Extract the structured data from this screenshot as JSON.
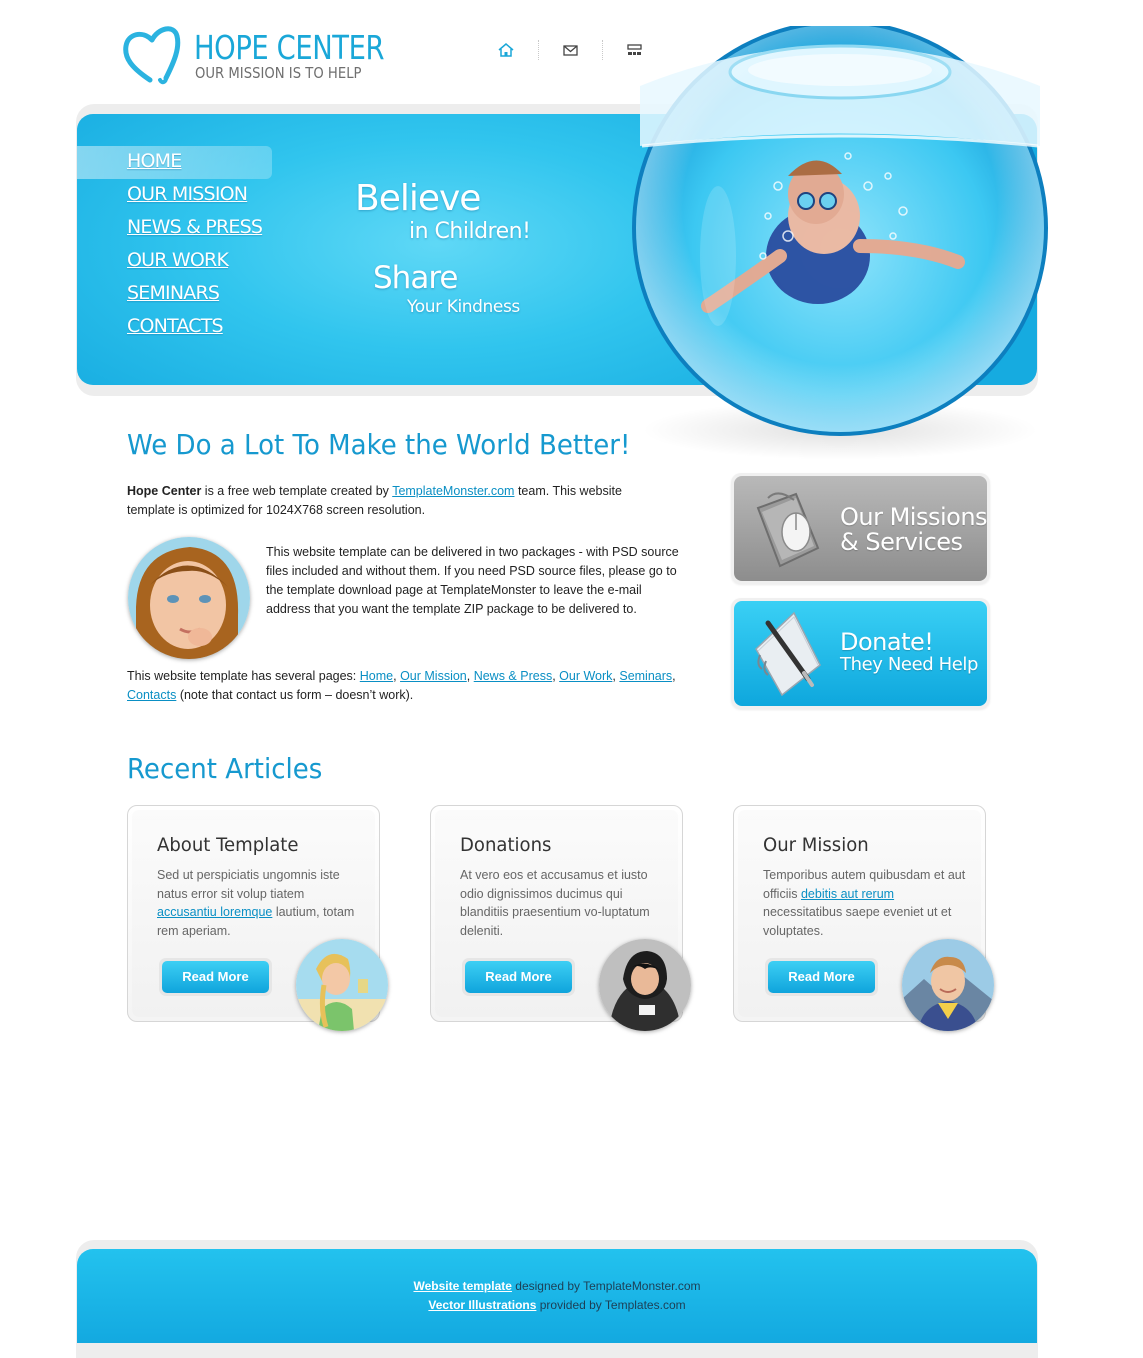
{
  "logo": {
    "title": "HOPE CENTER",
    "subtitle": "OUR MISSION IS TO HELP"
  },
  "top_icons": [
    "home-icon",
    "mail-icon",
    "sitemap-icon"
  ],
  "nav": {
    "items": [
      {
        "label": "HOME",
        "active": true
      },
      {
        "label": "OUR MISSION"
      },
      {
        "label": "NEWS & PRESS"
      },
      {
        "label": "OUR WORK"
      },
      {
        "label": "SEMINARS"
      },
      {
        "label": "CONTACTS"
      }
    ]
  },
  "banner": {
    "believe": "Believe",
    "in_children": "in Children!",
    "share": "Share",
    "your_kindness": "Your Kindness"
  },
  "main": {
    "heading": "We Do a Lot To Make the World Better!",
    "intro_bold": "Hope Center",
    "intro_pre": " is a free web template created by ",
    "intro_link": "TemplateMonster.com",
    "intro_post": " team. This website template is optimized for 1024X768 screen resolution.",
    "packages_text": "This website template can be delivered in two packages - with PSD source files included and without them. If you need PSD source files, please go to the template download page at TemplateMonster to leave the e-mail address that you want the template ZIP package to be delivered to.",
    "pages_pre": "This website template has several pages: ",
    "page_links": [
      "Home",
      "Our Mission",
      "News & Press",
      "Our Work",
      "Seminars",
      "Contacts"
    ],
    "pages_post": " (note that contact us form – doesn’t work)."
  },
  "side_boxes": {
    "missions": {
      "line1": "Our Missions",
      "line2": "& Services"
    },
    "donate": {
      "line1": "Donate!",
      "line2": "They Need Help"
    }
  },
  "recent": {
    "heading": "Recent Articles",
    "read_more": "Read More",
    "cards": [
      {
        "title": "About Template",
        "text_pre": "Sed ut perspiciatis ungomnis iste natus error sit volup tiatem ",
        "link": "accusantiu loremque",
        "text_post": " lautium, totam rem aperiam."
      },
      {
        "title": "Donations",
        "text_pre": "At vero eos et accusamus et iusto odio dignissimos ducimus qui blanditiis praesentium vo-luptatum deleniti.",
        "link": "",
        "text_post": ""
      },
      {
        "title": "Our Mission",
        "text_pre": "Temporibus autem quibusdam et aut officiis ",
        "link": "debitis aut rerum",
        "text_post": " necessitatibus saepe eveniet ut et voluptates."
      }
    ]
  },
  "footer": {
    "line1_link": "Website template",
    "line1_text": " designed by TemplateMonster.com",
    "line2_link": "Vector Illustrations",
    "line2_text": " provided by Templates.com"
  },
  "colors": {
    "accent": "#1aa7d8",
    "heading": "#1699cf",
    "banner": "#16abe0"
  }
}
